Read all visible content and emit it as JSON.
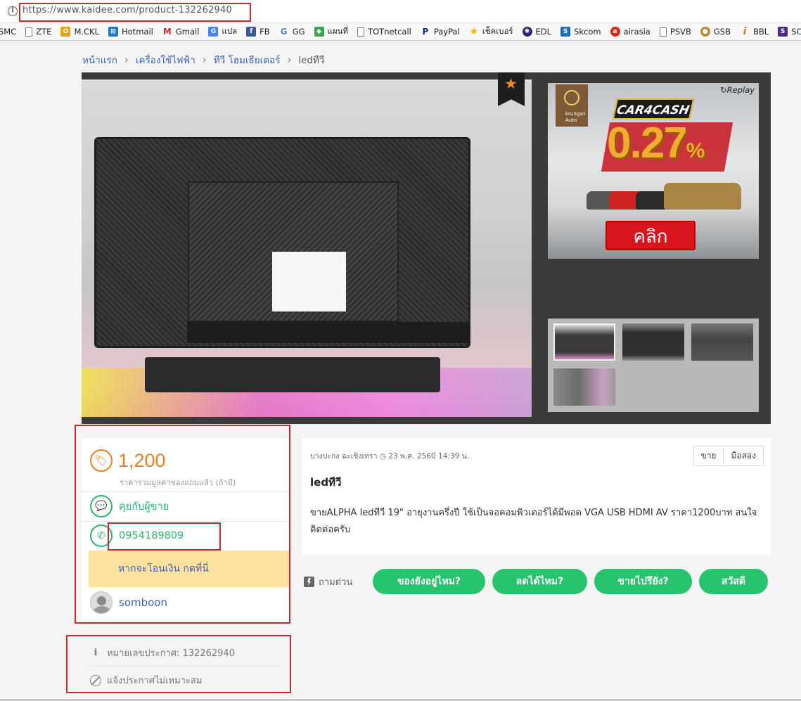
{
  "browser": {
    "url": "https://www.kaidee.com/product-132262940",
    "bookmarks": [
      {
        "label": "SMC",
        "icon": "page-icon"
      },
      {
        "label": "ZTE",
        "icon": "page-icon"
      },
      {
        "label": "M.CKL",
        "icon": "mckl-icon"
      },
      {
        "label": "Hotmail",
        "icon": "hotmail-icon"
      },
      {
        "label": "Gmail",
        "icon": "gmail-icon"
      },
      {
        "label": "แปล",
        "icon": "translate-icon"
      },
      {
        "label": "FB",
        "icon": "facebook-icon"
      },
      {
        "label": "GG",
        "icon": "google-icon"
      },
      {
        "label": "แผนที่",
        "icon": "maps-icon"
      },
      {
        "label": "TOTnetcall",
        "icon": "page-icon"
      },
      {
        "label": "PayPal",
        "icon": "paypal-icon"
      },
      {
        "label": "เช็คเบอร์",
        "icon": "star-icon"
      },
      {
        "label": "EDL",
        "icon": "edl-icon"
      },
      {
        "label": "Skcom",
        "icon": "skcom-icon"
      },
      {
        "label": "airasia",
        "icon": "airasia-icon"
      },
      {
        "label": "PSVB",
        "icon": "page-icon"
      },
      {
        "label": "GSB",
        "icon": "gsb-icon"
      },
      {
        "label": "BBL",
        "icon": "bbl-icon"
      },
      {
        "label": "SCB",
        "icon": "scb-icon"
      }
    ]
  },
  "breadcrumb": [
    "หน้าแรก",
    "เครื่องใช้ไฟฟ้า",
    "ทีวี โฮมเธียเตอร์",
    "ledทีวี"
  ],
  "ad": {
    "brand": "krungsri",
    "brand_sub": "Auto",
    "replay": "Replay",
    "headline": "CAR4CASH",
    "rate": "0.27",
    "rate_unit": "%",
    "cta": "คลิก"
  },
  "listing": {
    "price": "1,200",
    "price_note": "ราคารวมมูลค่าของแถมแล้ว (ถ้ามี)",
    "chat_label": "คุยกับผู้ขาย",
    "phone": "0954189809",
    "transfer_label": "หากจะโอนเงิน กดที่นี่",
    "seller": "somboon",
    "ad_number_label": "หมายเลขประกาศ: 132262940",
    "report_label": "แจ้งประกาศไม่เหมาะสม",
    "posted": "บางปะกง ฉะเชิงเทรา ◷ 23 พ.ค. 2560 14:39 น.",
    "tags": [
      "ขาย",
      "มือสอง"
    ],
    "title": "ledทีวี",
    "description": "ขายALPHA ledทีวี 19\" อายุงานครึ่งปี ใช้เป็นจอคอมพิวเตอร์ได้มีพอด VGA USB HDMI AV ราคา1200บาท สนใจติดต่อครับ"
  },
  "quick_ask": {
    "label": "ถามด่วน",
    "buttons": [
      "ของยังอยู่ไหม?",
      "ลดได้ไหม?",
      "ขายไปรึยัง?",
      "สวัสดี"
    ]
  },
  "colors": {
    "price": "#f07e1e",
    "green": "#27c46f",
    "link": "#3a63c4",
    "highlight": "#d0262f"
  }
}
